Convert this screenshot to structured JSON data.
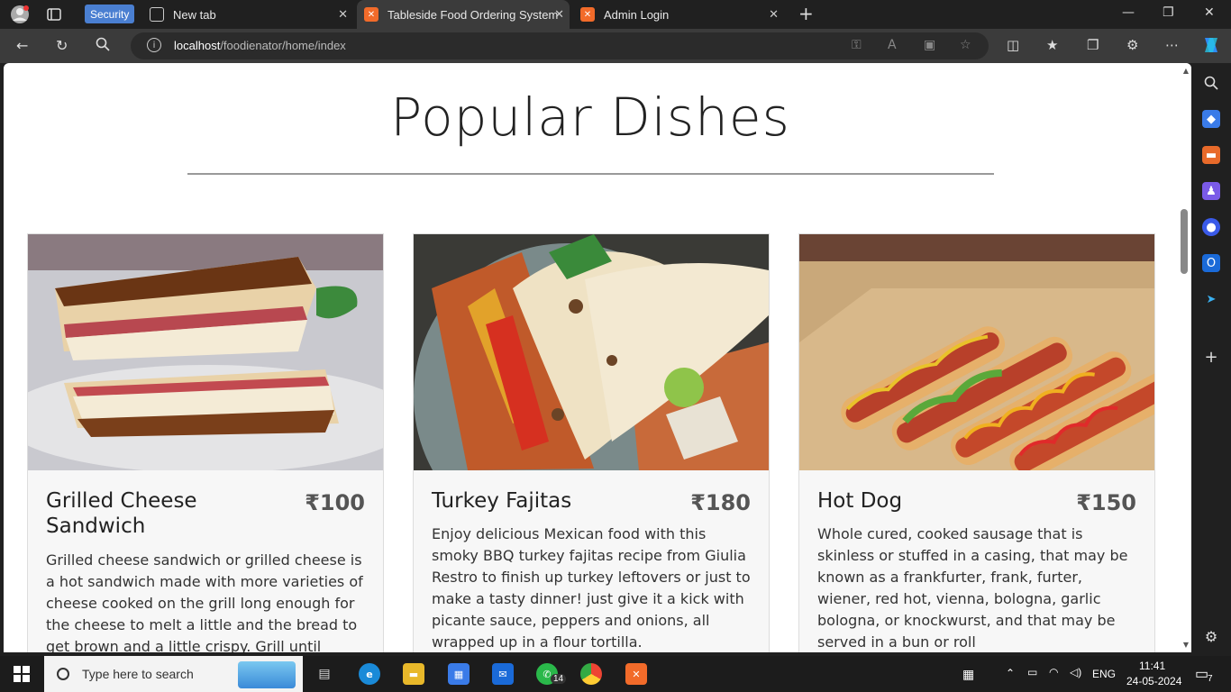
{
  "browser": {
    "security_label": "Security",
    "tabs": [
      {
        "title": "New tab"
      },
      {
        "title": "Tableside Food Ordering System"
      },
      {
        "title": "Admin Login"
      }
    ],
    "url_host": "localhost",
    "url_path": "/foodienator/home/index"
  },
  "page": {
    "title": "Popular Dishes",
    "dishes": [
      {
        "name": "Grilled Cheese Sandwich",
        "price": "₹100",
        "description": "Grilled cheese sandwich or grilled cheese is a hot sandwich made with more varieties of cheese cooked on the grill long enough for the cheese to melt a little and the bread to get brown and a little crispy. Grill until lightly"
      },
      {
        "name": "Turkey Fajitas",
        "price": "₹180",
        "description": "Enjoy delicious Mexican food with this smoky BBQ turkey fajitas recipe from Giulia Restro to finish up turkey leftovers or just to make a tasty dinner! just give it a kick with picante sauce, peppers and onions, all wrapped up in a flour tortilla."
      },
      {
        "name": "Hot Dog",
        "price": "₹150",
        "description": "Whole cured, cooked sausage that is skinless or stuffed in a casing, that may be known as a frankfurter, frank, furter, wiener, red hot, vienna, bologna, garlic bologna, or knockwurst, and that may be served in a bun or roll"
      }
    ]
  },
  "taskbar": {
    "search_placeholder": "Type here to search",
    "whatsapp_badge": "14",
    "language": "ENG",
    "time": "11:41",
    "date": "24-05-2024",
    "notification_count": "7"
  }
}
